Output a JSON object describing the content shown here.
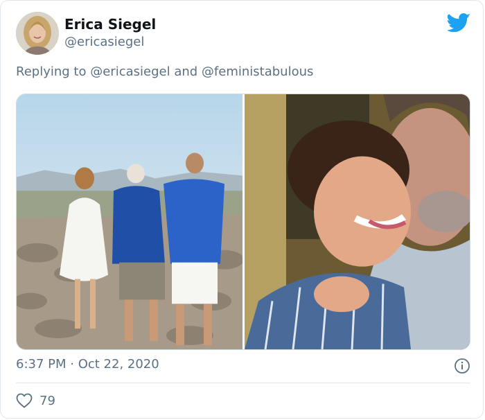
{
  "author": {
    "name": "Erica Siegel",
    "handle": "@ericasiegel"
  },
  "reply": {
    "prefix": "Replying to",
    "mention_1": "@ericasiegel",
    "joiner": "and",
    "mention_2": "@feministabulous"
  },
  "tweet": {
    "timestamp": "6:37 PM · Oct 22, 2020",
    "likes": "79"
  },
  "icons": {
    "brand": "twitter-bird-icon",
    "info": "info-icon",
    "like": "heart-icon"
  },
  "colors": {
    "brand_blue": "#1da1f2",
    "secondary_text": "#5b7083",
    "border": "#e1e8ed"
  }
}
